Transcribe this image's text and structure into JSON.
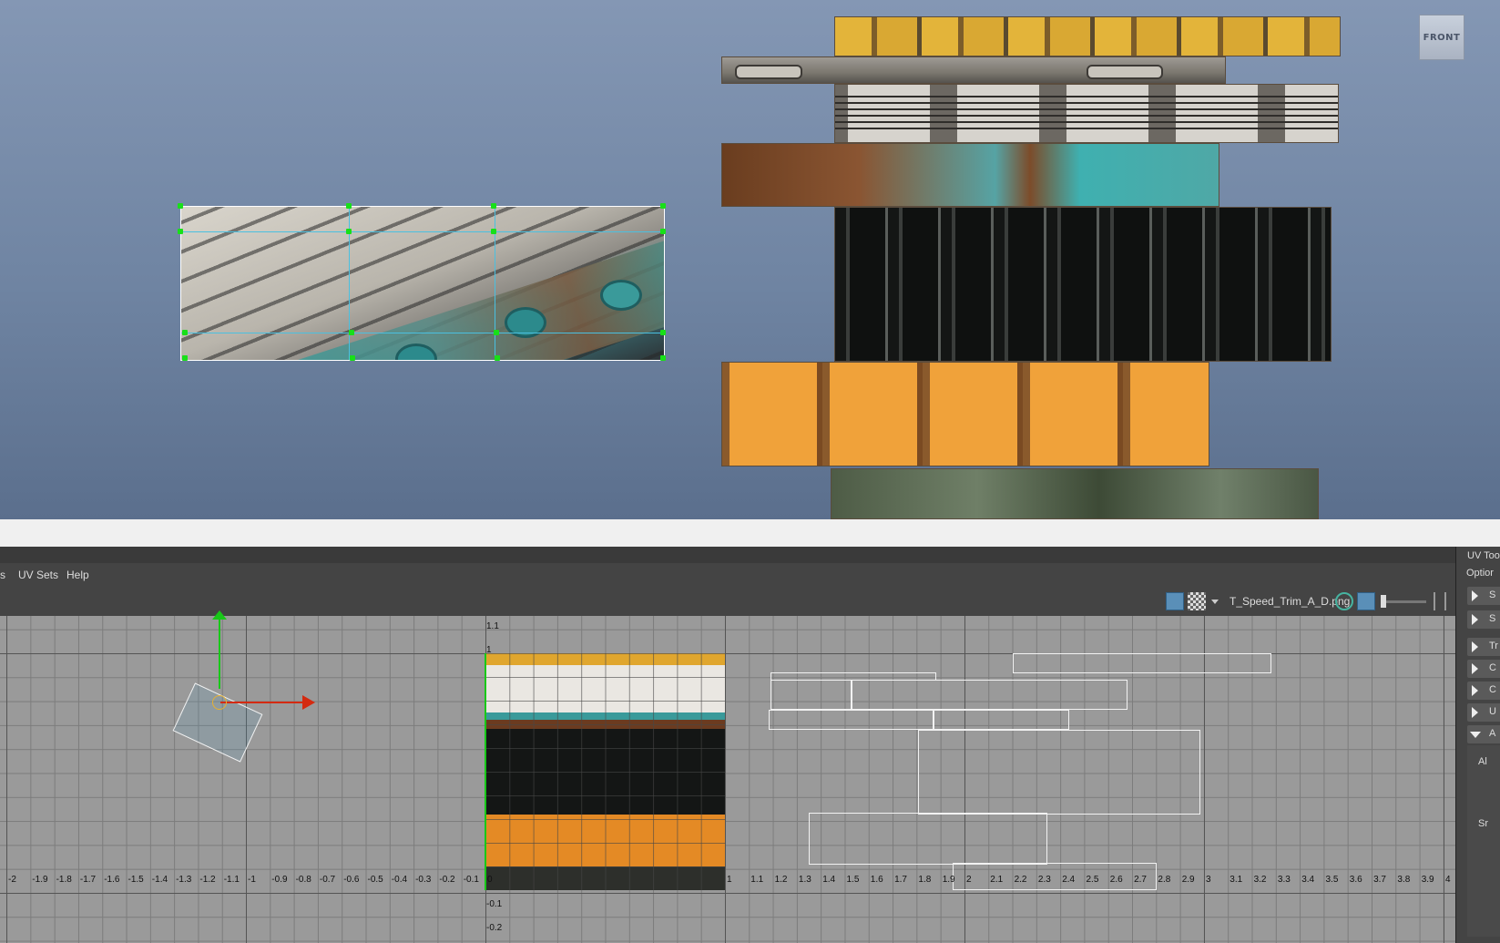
{
  "viewport": {
    "camera_label": "FRONT"
  },
  "uv_editor": {
    "menu": [
      "s",
      "UV Sets",
      "Help"
    ],
    "image_name": "T_Speed_Trim_A_D.png",
    "u_ticks": [
      "-2",
      "-1.9",
      "-1.8",
      "-1.7",
      "-1.6",
      "-1.5",
      "-1.4",
      "-1.3",
      "-1.2",
      "-1.1",
      "-1",
      "-0.9",
      "-0.8",
      "-0.7",
      "-0.6",
      "-0.5",
      "-0.4",
      "-0.3",
      "-0.2",
      "-0.1",
      "0",
      "1",
      "1.1",
      "1.2",
      "1.3",
      "1.4",
      "1.5",
      "1.6",
      "1.7",
      "1.8",
      "1.9",
      "2",
      "2.1",
      "2.2",
      "2.3",
      "2.4",
      "2.5",
      "2.6",
      "2.7",
      "2.8",
      "2.9",
      "3",
      "3.1",
      "3.2",
      "3.3",
      "3.4",
      "3.5",
      "3.6",
      "3.7",
      "3.8",
      "3.9",
      "4"
    ],
    "v_ticks": [
      "1.1",
      "1",
      "-0.1",
      "-0.2"
    ]
  },
  "uv_toolkit": {
    "title": "UV Too",
    "options": "Optior",
    "sections": [
      "S",
      "S",
      "Tr",
      "C",
      "C",
      "U",
      "A"
    ],
    "expanded_content": [
      "Al",
      "Sr"
    ]
  },
  "colors": {
    "selection": "#18e018",
    "manip_x": "#d42a10",
    "manip_y": "#18c818",
    "uv_shell": "#f2f2f2"
  }
}
